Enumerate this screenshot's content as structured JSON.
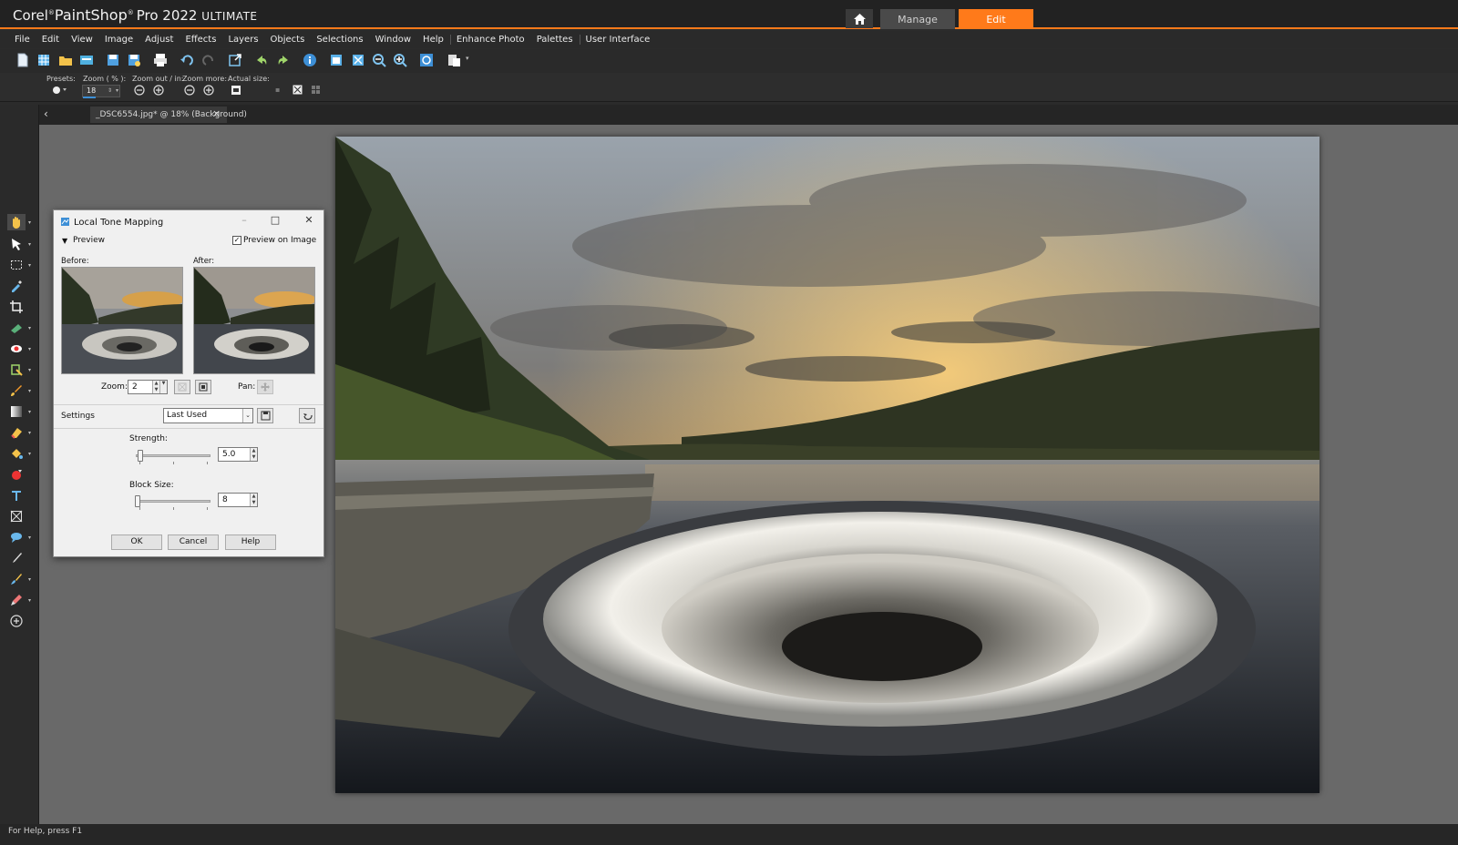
{
  "app": {
    "brand_prefix": "Corel",
    "brand_reg": "®",
    "brand_name": "PaintShop",
    "brand_reg2": "®",
    "brand_suffix": "Pro 2022",
    "edition": "ULTIMATE",
    "manage_tab": "Manage",
    "edit_tab": "Edit",
    "accent_color": "#ff7a1a"
  },
  "menu": {
    "items": [
      "File",
      "Edit",
      "View",
      "Image",
      "Adjust",
      "Effects",
      "Layers",
      "Objects",
      "Selections",
      "Window",
      "Help",
      "Enhance Photo",
      "Palettes",
      "User Interface"
    ]
  },
  "toolbar": {
    "icons": [
      "new-icon",
      "grid-icon",
      "open-icon",
      "scan-icon",
      "save-icon",
      "save-as-icon",
      "print-icon",
      "undo-icon",
      "redo-icon",
      "resize-icon",
      "undo-history-icon",
      "redo-history-icon",
      "info-icon",
      "fit-window-icon",
      "fit-image-icon",
      "zoom-out-icon",
      "zoom-in-icon",
      "actual-size-icon",
      "palette-icon"
    ]
  },
  "options": {
    "presets_label": "Presets:",
    "zoom_label": "Zoom ( % ):",
    "zoom_value": "18",
    "zoom_out_label": "Zoom out / in:",
    "zoom_more_label": "Zoom more:",
    "actual_size_label": "Actual size:"
  },
  "document_tab": {
    "label": "_DSC6554.jpg* @  18% (Background)",
    "close": "×",
    "back": "‹"
  },
  "status": {
    "text": "For Help, press F1"
  },
  "dialog": {
    "title": "Local Tone Mapping",
    "preview_toggle": "Preview",
    "preview_on_image": "Preview on Image",
    "preview_on_image_checked": true,
    "before_label": "Before:",
    "after_label": "After:",
    "zoom_label": "Zoom:",
    "zoom_value": "2",
    "pan_label": "Pan:",
    "settings_label": "Settings",
    "settings_value": "Last Used",
    "strength_label": "Strength:",
    "strength_value": "5.0",
    "block_size_label": "Block Size:",
    "block_size_value": "8",
    "ok": "OK",
    "cancel": "Cancel",
    "help": "Help"
  }
}
